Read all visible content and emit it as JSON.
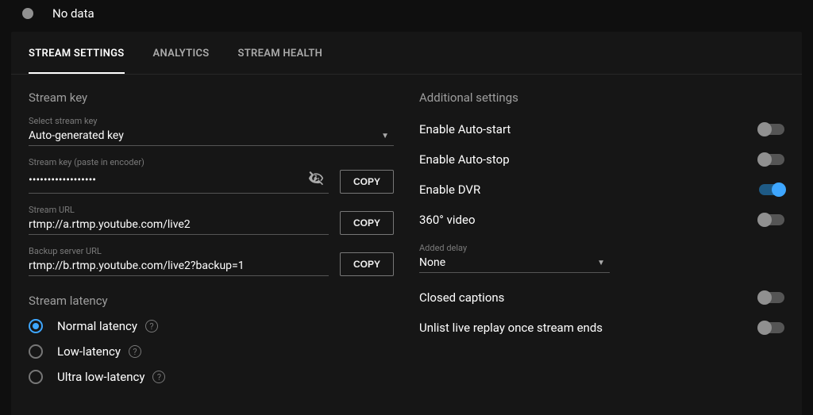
{
  "top": {
    "label": "No data"
  },
  "tabs": {
    "stream_settings": "STREAM SETTINGS",
    "analytics": "ANALYTICS",
    "stream_health": "STREAM HEALTH"
  },
  "stream_key": {
    "section_title": "Stream key",
    "select_label": "Select stream key",
    "select_value": "Auto-generated key",
    "key_label": "Stream key (paste in encoder)",
    "key_value": "••••••••••••••••••",
    "url_label": "Stream URL",
    "url_value": "rtmp://a.rtmp.youtube.com/live2",
    "backup_label": "Backup server URL",
    "backup_value": "rtmp://b.rtmp.youtube.com/live2?backup=1",
    "copy_button": "COPY"
  },
  "latency": {
    "section_title": "Stream latency",
    "normal": "Normal latency",
    "low": "Low-latency",
    "ultra": "Ultra low-latency"
  },
  "additional": {
    "section_title": "Additional settings",
    "auto_start": "Enable Auto-start",
    "auto_stop": "Enable Auto-stop",
    "dvr": "Enable DVR",
    "video360": "360° video",
    "delay_label": "Added delay",
    "delay_value": "None",
    "closed_captions": "Closed captions",
    "unlist": "Unlist live replay once stream ends"
  }
}
